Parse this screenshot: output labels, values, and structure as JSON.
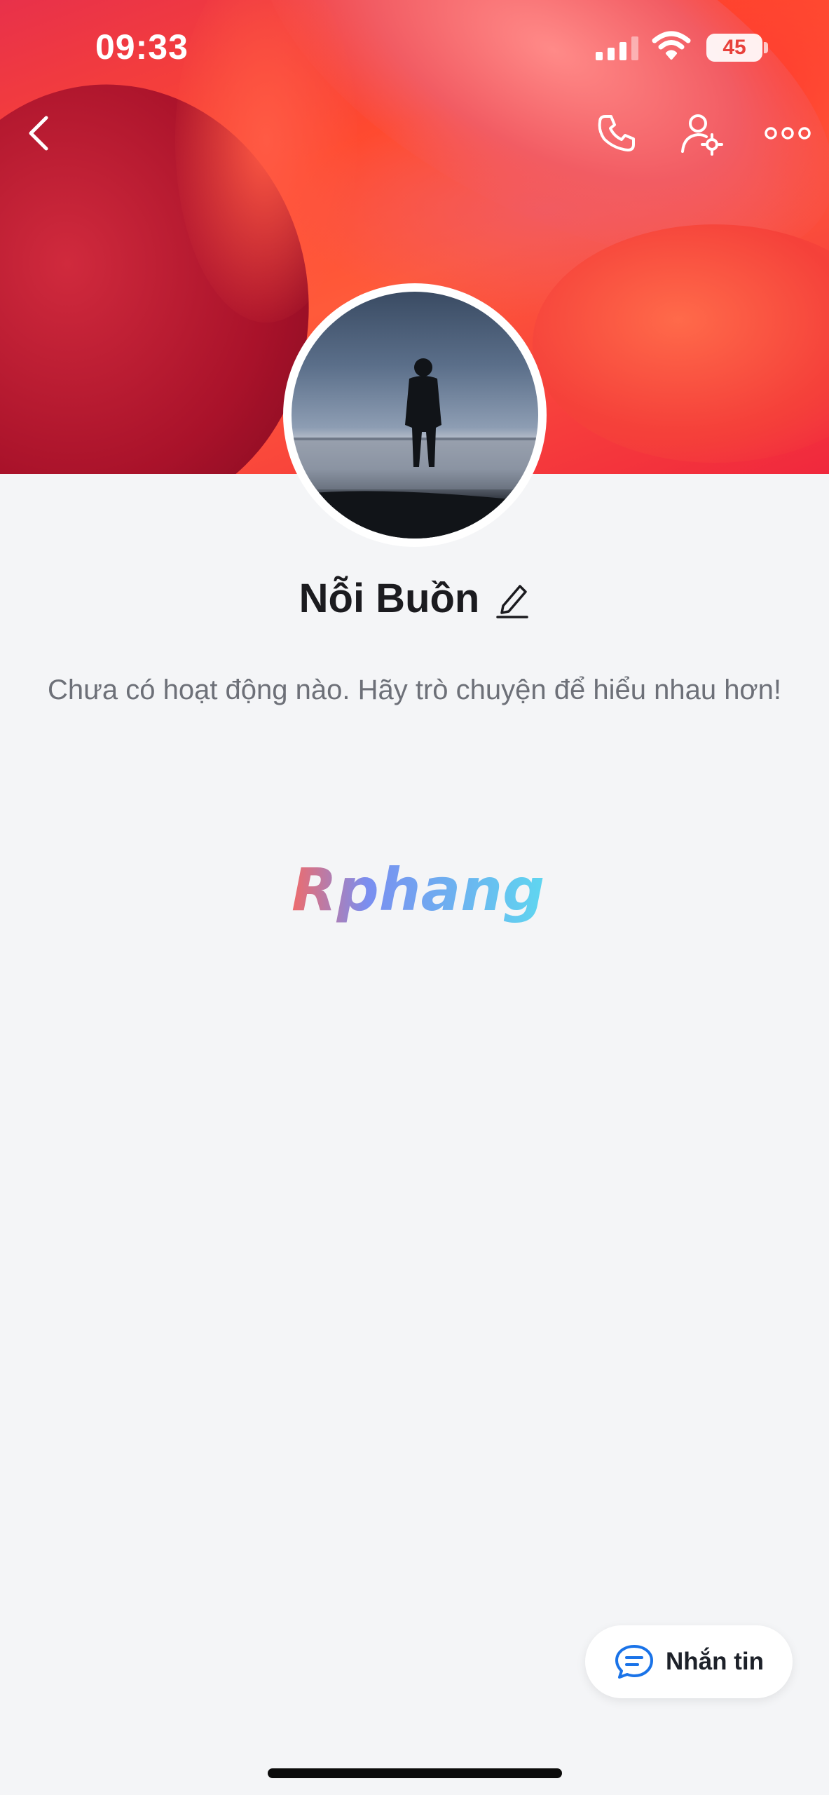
{
  "status_bar": {
    "time": "09:33",
    "battery": "45"
  },
  "header": {
    "back_icon": "chevron-left-icon",
    "call_icon": "phone-icon",
    "settings_icon": "user-settings-icon",
    "more_icon": "more-horizontal-icon"
  },
  "profile": {
    "name": "Nỗi Buồn",
    "activity_text": "Chưa có hoạt động nào. Hãy trò chuyện để hiểu nhau hơn!"
  },
  "watermark": {
    "text": "Rphang"
  },
  "message_button": {
    "label": "Nhắn tin"
  },
  "colors": {
    "accent": "#1a73e8",
    "cover": "#f0283d",
    "background": "#f4f5f7"
  }
}
